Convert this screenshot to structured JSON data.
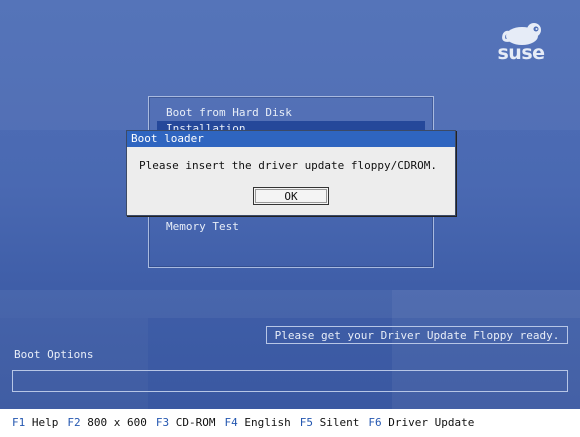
{
  "logo": {
    "text": "suse"
  },
  "menu": {
    "items": [
      {
        "label": "Boot from Hard Disk"
      },
      {
        "label": "Installation",
        "selected": true
      },
      {
        "label": "Memory Test"
      }
    ]
  },
  "dialog": {
    "title": "Boot loader",
    "message": "Please insert the driver update floppy/CDROM.",
    "ok_label": "OK"
  },
  "hint": "Please get your Driver Update Floppy ready.",
  "boot_options": {
    "label": "Boot Options",
    "value": ""
  },
  "function_keys": [
    {
      "key": "F1",
      "label": "Help"
    },
    {
      "key": "F2",
      "label": "800 x 600"
    },
    {
      "key": "F3",
      "label": "CD-ROM"
    },
    {
      "key": "F4",
      "label": "English"
    },
    {
      "key": "F5",
      "label": "Silent"
    },
    {
      "key": "F6",
      "label": "Driver Update"
    }
  ],
  "colors": {
    "background": "#4a69b2",
    "selection": "#25489a",
    "dialog_title": "#2f65c0",
    "fkey": "#2457b0"
  }
}
